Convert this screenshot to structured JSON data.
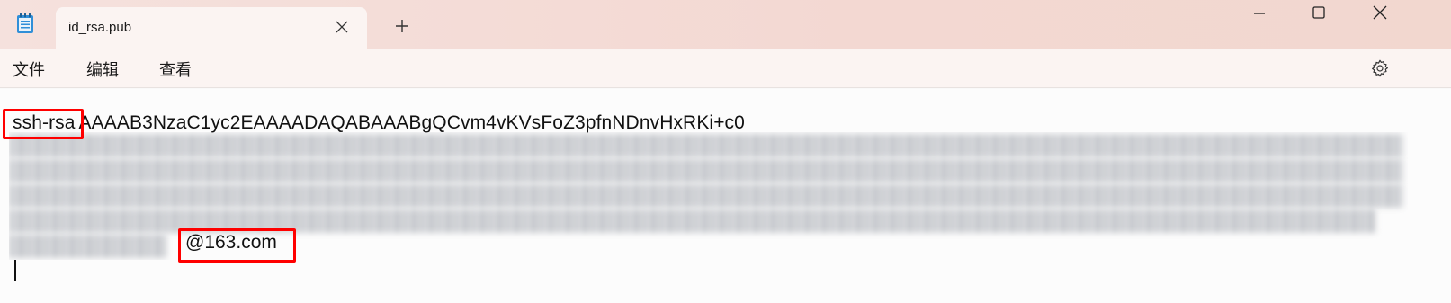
{
  "window": {
    "tab_title": "id_rsa.pub",
    "icons": {
      "app": "notepad-icon",
      "tab_close": "close-icon",
      "new_tab": "plus-icon",
      "minimize": "minimize-icon",
      "maximize": "maximize-icon",
      "close": "close-icon"
    }
  },
  "menu": {
    "file": "文件",
    "edit": "编辑",
    "view": "查看",
    "settings_icon": "gear-icon"
  },
  "editor": {
    "key_type": "ssh-rsa",
    "key_start": "AAAAB3NzaC1yc2EAAAADAQABAAABgQCvm4vKVsFoZ3pfnNDnvHxRKi+c0",
    "email_suffix": "@163.com",
    "blurred_note": "",
    "highlight_color": "#ff0000"
  }
}
